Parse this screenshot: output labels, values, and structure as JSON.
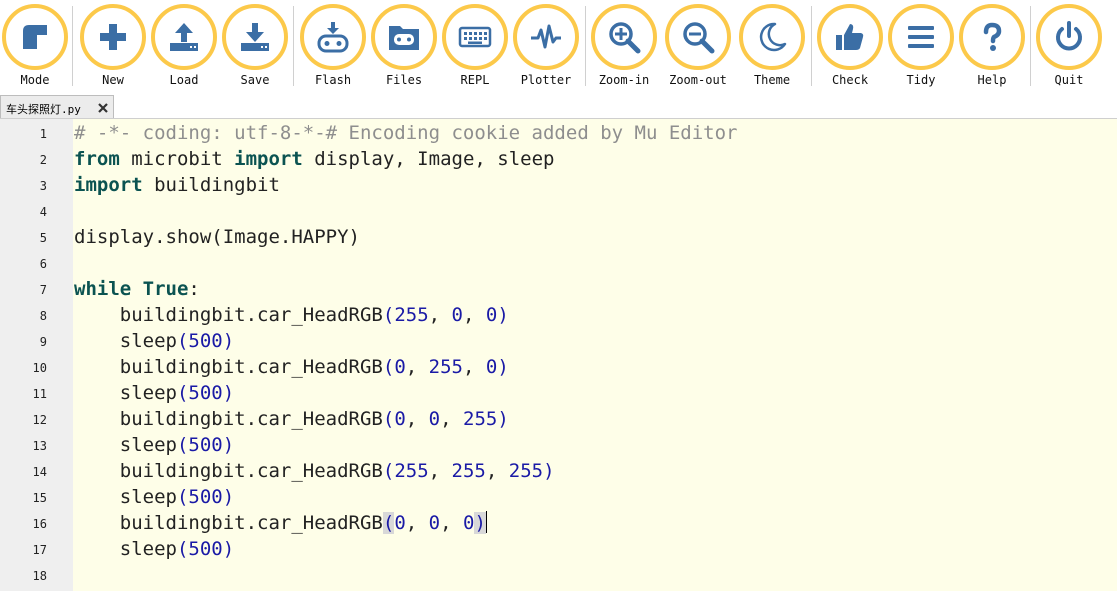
{
  "toolbar": {
    "buttons": [
      {
        "id": "mode",
        "label": "Mode",
        "icon": "mode-icon"
      },
      {
        "id": "new",
        "label": "New",
        "icon": "plus-icon"
      },
      {
        "id": "load",
        "label": "Load",
        "icon": "upload-icon"
      },
      {
        "id": "save",
        "label": "Save",
        "icon": "download-icon"
      },
      {
        "id": "flash",
        "label": "Flash",
        "icon": "flash-icon"
      },
      {
        "id": "files",
        "label": "Files",
        "icon": "files-icon"
      },
      {
        "id": "repl",
        "label": "REPL",
        "icon": "keyboard-icon"
      },
      {
        "id": "plotter",
        "label": "Plotter",
        "icon": "pulse-icon"
      },
      {
        "id": "zoom_in",
        "label": "Zoom-in",
        "icon": "zoom-in-icon"
      },
      {
        "id": "zoom_out",
        "label": "Zoom-out",
        "icon": "zoom-out-icon"
      },
      {
        "id": "theme",
        "label": "Theme",
        "icon": "moon-icon"
      },
      {
        "id": "check",
        "label": "Check",
        "icon": "thumbs-up-icon"
      },
      {
        "id": "tidy",
        "label": "Tidy",
        "icon": "lines-icon"
      },
      {
        "id": "help",
        "label": "Help",
        "icon": "question-icon"
      },
      {
        "id": "quit",
        "label": "Quit",
        "icon": "power-icon"
      }
    ],
    "accent_color": "#fcc94a",
    "icon_color": "#3b6ea5"
  },
  "tabs": [
    {
      "label": "车头探照灯.py",
      "close": "✖"
    }
  ],
  "editor": {
    "background": "#fefee8",
    "lines": [
      {
        "n": "1",
        "text": "# -*- coding: utf-8-*-# Encoding cookie added by Mu Editor"
      },
      {
        "n": "2",
        "text": "from microbit import display, Image, sleep"
      },
      {
        "n": "3",
        "text": "import buildingbit"
      },
      {
        "n": "4",
        "text": ""
      },
      {
        "n": "5",
        "text": "display.show(Image.HAPPY)"
      },
      {
        "n": "6",
        "text": ""
      },
      {
        "n": "7",
        "text": "while True:"
      },
      {
        "n": "8",
        "text": "    buildingbit.car_HeadRGB(255, 0, 0)"
      },
      {
        "n": "9",
        "text": "    sleep(500)"
      },
      {
        "n": "10",
        "text": "    buildingbit.car_HeadRGB(0, 255, 0)"
      },
      {
        "n": "11",
        "text": "    sleep(500)"
      },
      {
        "n": "12",
        "text": "    buildingbit.car_HeadRGB(0, 0, 255)"
      },
      {
        "n": "13",
        "text": "    sleep(500)"
      },
      {
        "n": "14",
        "text": "    buildingbit.car_HeadRGB(255, 255, 255)"
      },
      {
        "n": "15",
        "text": "    sleep(500)"
      },
      {
        "n": "16",
        "text": "    buildingbit.car_HeadRGB(0, 0, 0)"
      },
      {
        "n": "17",
        "text": "    sleep(500)"
      },
      {
        "n": "18",
        "text": ""
      }
    ]
  }
}
